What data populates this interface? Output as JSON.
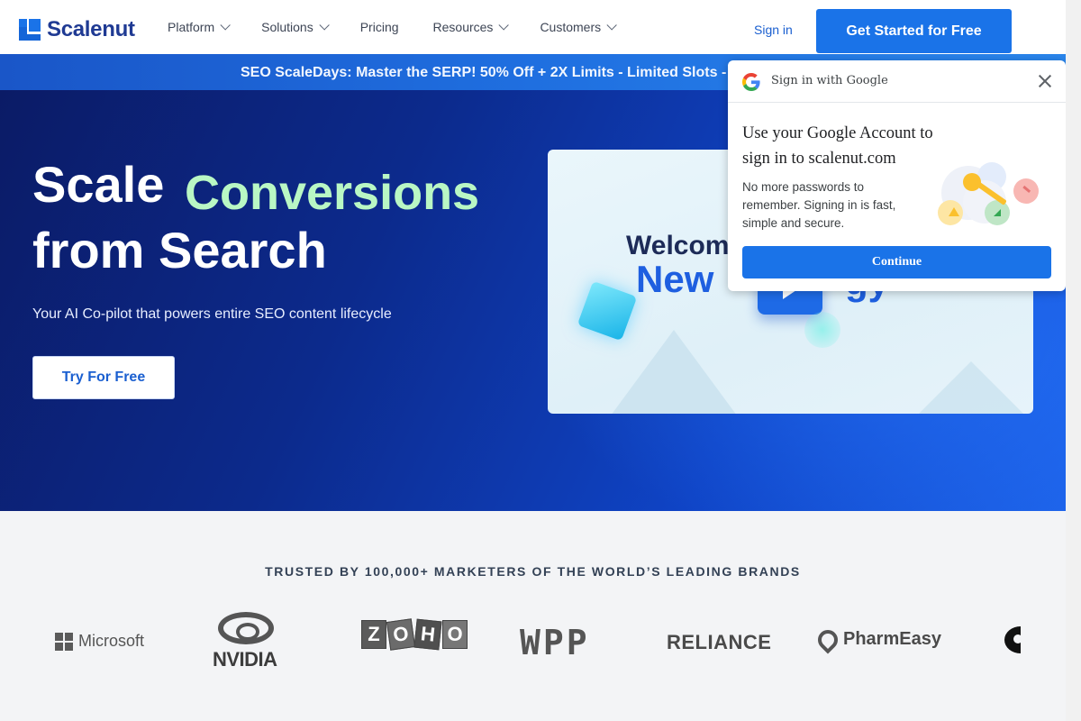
{
  "nav": {
    "logo_text": "Scalenut",
    "menu": [
      {
        "label": "Platform",
        "has_dropdown": true
      },
      {
        "label": "Solutions",
        "has_dropdown": true
      },
      {
        "label": "Pricing",
        "has_dropdown": false
      },
      {
        "label": "Resources",
        "has_dropdown": true
      },
      {
        "label": "Customers",
        "has_dropdown": true
      }
    ],
    "sign_in": "Sign in",
    "cta": "Get Started for Free"
  },
  "banner": {
    "text": "SEO ScaleDays: Master the SERP! 50% Off + 2X Limits - Limited Slots -"
  },
  "hero": {
    "title_word1": "Scale",
    "title_highlight": "Conversions",
    "title_line2": "from Search",
    "subtitle": "Your AI Co-pilot that powers entire SEO content lifecycle",
    "cta": "Try For Free",
    "video": {
      "line1": "Welcom",
      "line2": "New",
      "line3": "gy"
    }
  },
  "trusted": {
    "title": "TRUSTED BY 100,000+ MARKETERS OF THE WORLD’S LEADING BRANDS",
    "brands": [
      "Microsoft",
      "NVIDIA",
      "ZOHO",
      "WPP",
      "RELIANCE",
      "PharmEasy"
    ]
  },
  "google_popup": {
    "header": "Sign in with Google",
    "title": "Use your Google Account to sign in to scalenut.com",
    "description": "No more passwords to remember. Signing in is fast, simple and secure.",
    "continue": "Continue"
  },
  "colors": {
    "brand_blue": "#1a73e8",
    "hero_dark": "#0b1b66",
    "highlight_green": "#b9f7c4"
  }
}
